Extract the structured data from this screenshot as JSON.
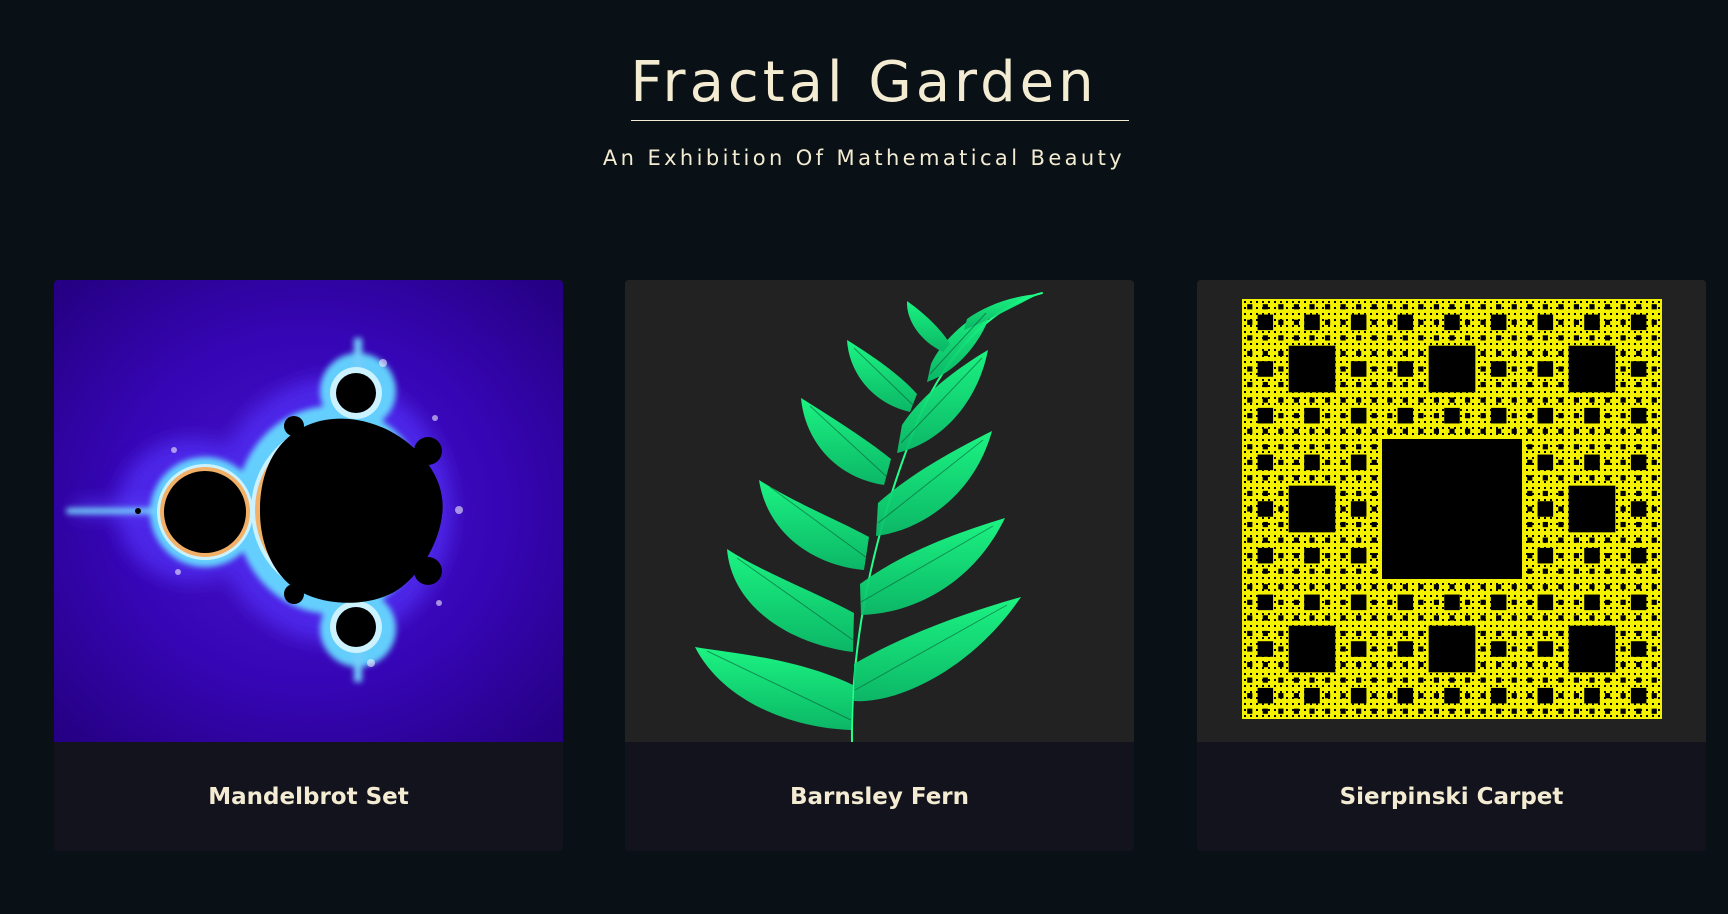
{
  "header": {
    "title": "Fractal Garden",
    "subtitle": "An Exhibition Of Mathematical Beauty"
  },
  "gallery": {
    "cards": [
      {
        "title": "Mandelbrot Set"
      },
      {
        "title": "Barnsley Fern"
      },
      {
        "title": "Sierpinski Carpet"
      }
    ]
  },
  "colors": {
    "page_background": "#0a1116",
    "title_text": "#f4ecd2",
    "caption_background": "#13131d",
    "image_panel_dark": "#222222",
    "mandelbrot_background": "#3b05b0",
    "mandelbrot_glow": "#75d8ff",
    "fern_green": "#14e87f",
    "carpet_yellow": "#f3f000"
  }
}
